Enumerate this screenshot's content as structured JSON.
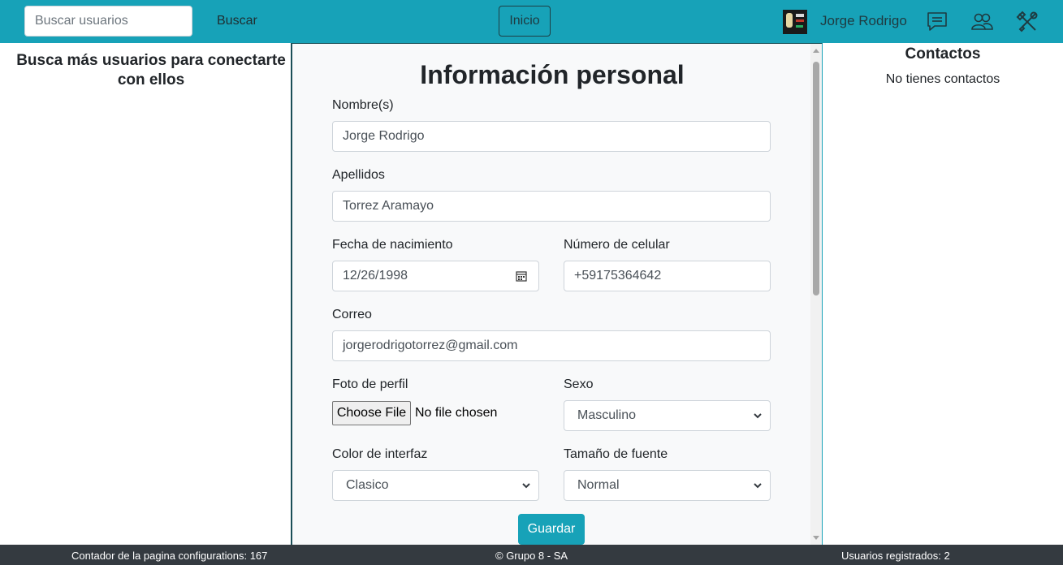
{
  "navbar": {
    "search_placeholder": "Buscar usuarios",
    "search_button": "Buscar",
    "home_button": "Inicio",
    "user_name": "Jorge Rodrigo",
    "icons": [
      "chat-icon",
      "people-icon",
      "tools-icon"
    ],
    "background_color": "#17a2b8"
  },
  "left": {
    "title": "Busca más usuarios para conectarte con ellos"
  },
  "form": {
    "title": "Información personal",
    "nombres_label": "Nombre(s)",
    "nombres_value": "Jorge Rodrigo",
    "apellidos_label": "Apellidos",
    "apellidos_value": "Torrez Aramayo",
    "fecha_label": "Fecha de nacimiento",
    "fecha_value": "12/26/1998",
    "celular_label": "Número de celular",
    "celular_value": "+59175364642",
    "correo_label": "Correo",
    "correo_value": "jorgerodrigotorrez@gmail.com",
    "foto_label": "Foto de perfil",
    "foto_button": "Choose File",
    "foto_status": "No file chosen",
    "sexo_label": "Sexo",
    "sexo_value": "Masculino",
    "color_label": "Color de interfaz",
    "color_value": "Clasico",
    "fuente_label": "Tamaño de fuente",
    "fuente_value": "Normal",
    "save_button": "Guardar"
  },
  "right": {
    "title": "Contactos",
    "empty_text": "No tienes contactos"
  },
  "footer": {
    "counter": "Contador de la pagina configurations: 167",
    "copyright": "© Grupo 8 - SA",
    "users": "Usuarios registrados: 2"
  }
}
